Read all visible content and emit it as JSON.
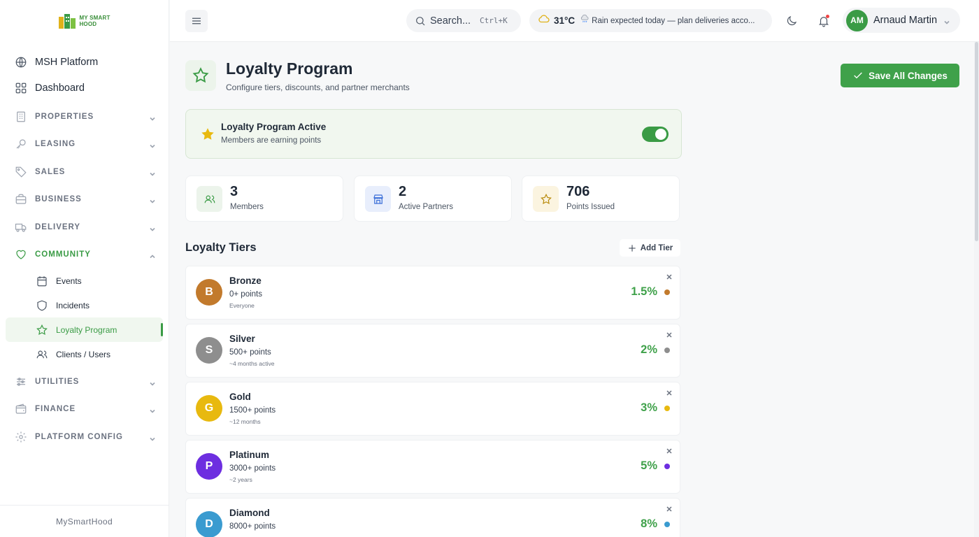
{
  "brand": {
    "logo_line1": "MY SMART",
    "logo_line2": "HOOD",
    "footer": "MySmartHood"
  },
  "sidebar": {
    "top": [
      {
        "label": "MSH Platform",
        "icon": "globe-icon"
      },
      {
        "label": "Dashboard",
        "icon": "grid-icon"
      }
    ],
    "sections": [
      {
        "label": "PROPERTIES",
        "icon": "building-icon"
      },
      {
        "label": "LEASING",
        "icon": "key-icon"
      },
      {
        "label": "SALES",
        "icon": "tag-icon"
      },
      {
        "label": "BUSINESS",
        "icon": "briefcase-icon"
      },
      {
        "label": "DELIVERY",
        "icon": "truck-icon"
      },
      {
        "label": "COMMUNITY",
        "icon": "heart-icon",
        "expanded": true
      },
      {
        "label": "UTILITIES",
        "icon": "sliders-icon"
      },
      {
        "label": "FINANCE",
        "icon": "wallet-icon"
      },
      {
        "label": "PLATFORM CONFIG",
        "icon": "gear-icon"
      }
    ],
    "community_items": [
      {
        "label": "Events",
        "icon": "calendar-icon"
      },
      {
        "label": "Incidents",
        "icon": "shield-icon"
      },
      {
        "label": "Loyalty Program",
        "icon": "star-icon",
        "active": true
      },
      {
        "label": "Clients / Users",
        "icon": "users-icon"
      }
    ]
  },
  "topbar": {
    "search_placeholder": "Search...",
    "search_shortcut": "Ctrl+K",
    "weather_temp": "31°C",
    "weather_message": "Rain expected today — plan deliveries acco...",
    "user_initials": "AM",
    "user_name": "Arnaud Martin"
  },
  "page": {
    "title": "Loyalty Program",
    "subtitle": "Configure tiers, discounts, and partner merchants",
    "save_label": "Save All Changes"
  },
  "status": {
    "title": "Loyalty Program Active",
    "subtitle": "Members are earning points",
    "enabled": true
  },
  "stats": [
    {
      "value": "3",
      "label": "Members",
      "icon": "users-icon"
    },
    {
      "value": "2",
      "label": "Active Partners",
      "icon": "store-icon"
    },
    {
      "value": "706",
      "label": "Points Issued",
      "icon": "star-icon"
    }
  ],
  "tiers_section": {
    "title": "Loyalty Tiers",
    "add_label": "Add Tier"
  },
  "tiers": [
    {
      "initial": "B",
      "name": "Bronze",
      "points": "0+ points",
      "note": "Everyone",
      "discount": "1.5%",
      "color": "#c27a2c"
    },
    {
      "initial": "S",
      "name": "Silver",
      "points": "500+ points",
      "note": "~4 months active",
      "discount": "2%",
      "color": "#8e8e8e"
    },
    {
      "initial": "G",
      "name": "Gold",
      "points": "1500+ points",
      "note": "~12 months",
      "discount": "3%",
      "color": "#e8b90f"
    },
    {
      "initial": "P",
      "name": "Platinum",
      "points": "3000+ points",
      "note": "~2 years",
      "discount": "5%",
      "color": "#6d2ee0"
    },
    {
      "initial": "D",
      "name": "Diamond",
      "points": "8000+ points",
      "note": "",
      "discount": "8%",
      "color": "#3a9bd0"
    }
  ],
  "colors": {
    "accent": "#3a9b45",
    "discount": "#3fa14a"
  }
}
